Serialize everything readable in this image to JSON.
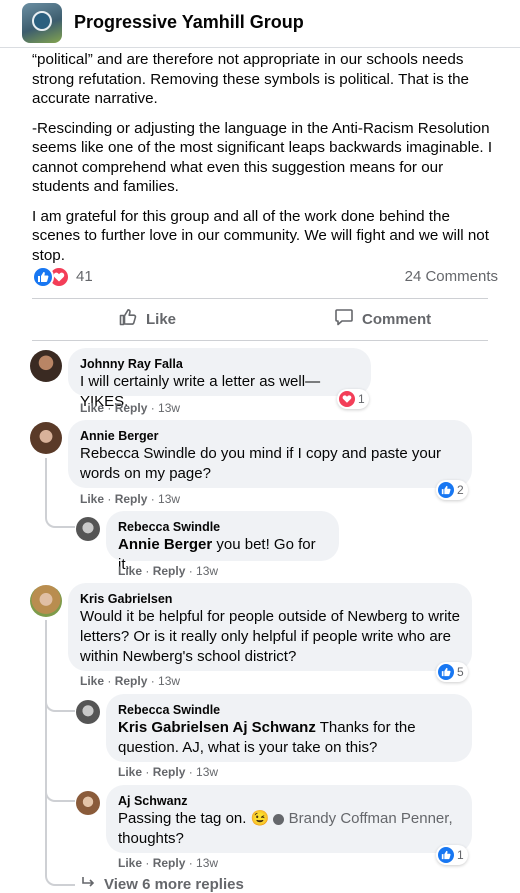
{
  "header": {
    "group_name": "Progressive Yamhill Group"
  },
  "post": {
    "paragraphs": [
      "“political” and are therefore not appropriate in our schools needs strong refutation. Removing these symbols is political. That is the accurate narrative.",
      "-Rescinding or adjusting the language in the Anti-Racism Resolution seems like one of the most significant leaps backwards imaginable. I cannot comprehend what even this suggestion means for our students and families.",
      "I am grateful for this group and all of the work done behind the scenes to further love in our community. We will fight and we will not stop."
    ],
    "reaction_count": "41",
    "comments_count": "24 Comments",
    "like_label": "Like",
    "comment_label": "Comment"
  },
  "comments": [
    {
      "name": "Johnny Ray Falla",
      "text": "I will certainly write a letter as well—YIKES.",
      "like": "Like",
      "reply": "Reply",
      "time": "13w",
      "reaction": "love",
      "reaction_count": "1"
    },
    {
      "name": "Annie Berger",
      "text": "Rebecca Swindle do you mind if I copy and paste your words on my page?",
      "like": "Like",
      "reply": "Reply",
      "time": "13w",
      "reaction": "like",
      "reaction_count": "2"
    },
    {
      "name": "Rebecca Swindle",
      "mention": "Annie Berger",
      "text": " you bet! Go for it.",
      "like": "Like",
      "reply": "Reply",
      "time": "13w"
    },
    {
      "name": "Kris Gabrielsen",
      "text": "Would it be helpful for people outside of Newberg to write letters? Or is it really only helpful if people write who are within Newberg's school district?",
      "like": "Like",
      "reply": "Reply",
      "time": "13w",
      "reaction": "like",
      "reaction_count": "5"
    },
    {
      "name": "Rebecca Swindle",
      "mention": "Kris Gabrielsen Aj Schwanz",
      "text": " Thanks for the question. AJ, what is your take on this?",
      "like": "Like",
      "reply": "Reply",
      "time": "13w"
    },
    {
      "name": "Aj Schwanz",
      "text_a": "Passing the tag on. ",
      "emoji": "😉",
      "mention": "Brandy Coffman Penner,",
      "text_b": "thoughts?",
      "like": "Like",
      "reply": "Reply",
      "time": "13w",
      "reaction": "like",
      "reaction_count": "1"
    }
  ],
  "view_more": "View 6 more replies",
  "colors": {
    "like_blue": "#1877f2",
    "love_red": "#f33e58",
    "bubble": "#f0f2f5",
    "muted": "#65676b"
  }
}
